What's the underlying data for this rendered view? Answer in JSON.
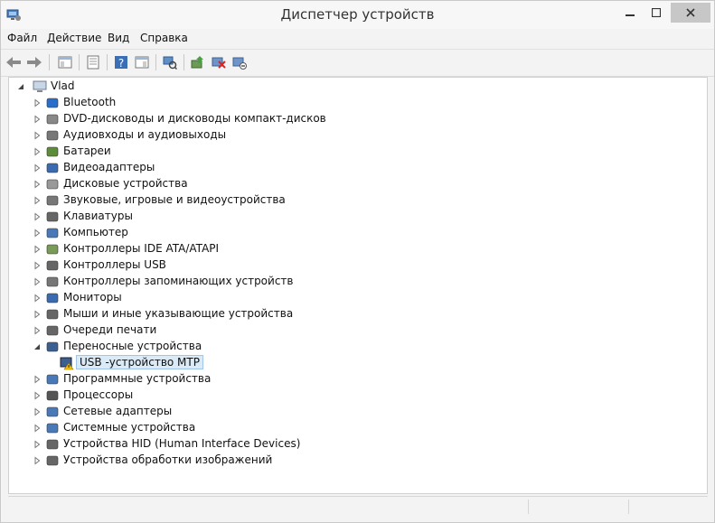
{
  "window": {
    "title": "Диспетчер устройств"
  },
  "menu": [
    "Файл",
    "Действие",
    "Вид",
    "Справка"
  ],
  "toolbar": {
    "buttons": [
      "back-icon",
      "forward-icon",
      "show-hide-tree-icon",
      "properties-icon",
      "help-icon",
      "action-pane-icon",
      "scan-hardware-icon",
      "update-driver-icon",
      "disable-device-icon",
      "uninstall-device-icon"
    ]
  },
  "tree": {
    "root": "Vlad",
    "categories": [
      "Bluetooth",
      "DVD-дисководы и дисководы компакт-дисков",
      "Аудиовходы и аудиовыходы",
      "Батареи",
      "Видеоадаптеры",
      "Дисковые устройства",
      "Звуковые, игровые и видеоустройства",
      "Клавиатуры",
      "Компьютер",
      "Контроллеры IDE ATA/ATAPI",
      "Контроллеры USB",
      "Контроллеры запоминающих устройств",
      "Мониторы",
      "Мыши и иные указывающие устройства",
      "Очереди печати",
      "Переносные устройства",
      "Программные устройства",
      "Процессоры",
      "Сетевые адаптеры",
      "Системные устройства",
      "Устройства HID (Human Interface Devices)",
      "Устройства обработки изображений"
    ],
    "expanded_index": 15,
    "child": "USB -устройство MTP"
  }
}
